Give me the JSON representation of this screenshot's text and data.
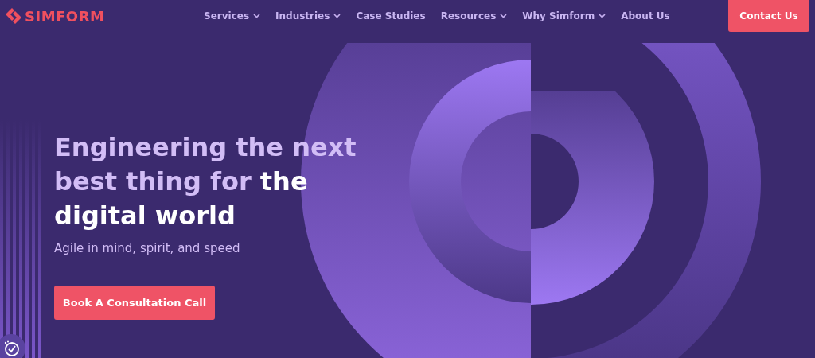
{
  "brand": {
    "name": "SIMFORM"
  },
  "nav": [
    {
      "label": "Services",
      "has_menu": true
    },
    {
      "label": "Industries",
      "has_menu": true
    },
    {
      "label": "Case Studies",
      "has_menu": false
    },
    {
      "label": "Resources",
      "has_menu": true
    },
    {
      "label": "Why Simform",
      "has_menu": true
    },
    {
      "label": "About Us",
      "has_menu": false
    }
  ],
  "contact_button": "Contact Us",
  "hero": {
    "headline_lead": "Engineering the next best thing for",
    "headline_emphasis": "the digital world",
    "subtitle": "Agile in mind, spirit, and speed",
    "cta": "Book A Consultation Call"
  }
}
